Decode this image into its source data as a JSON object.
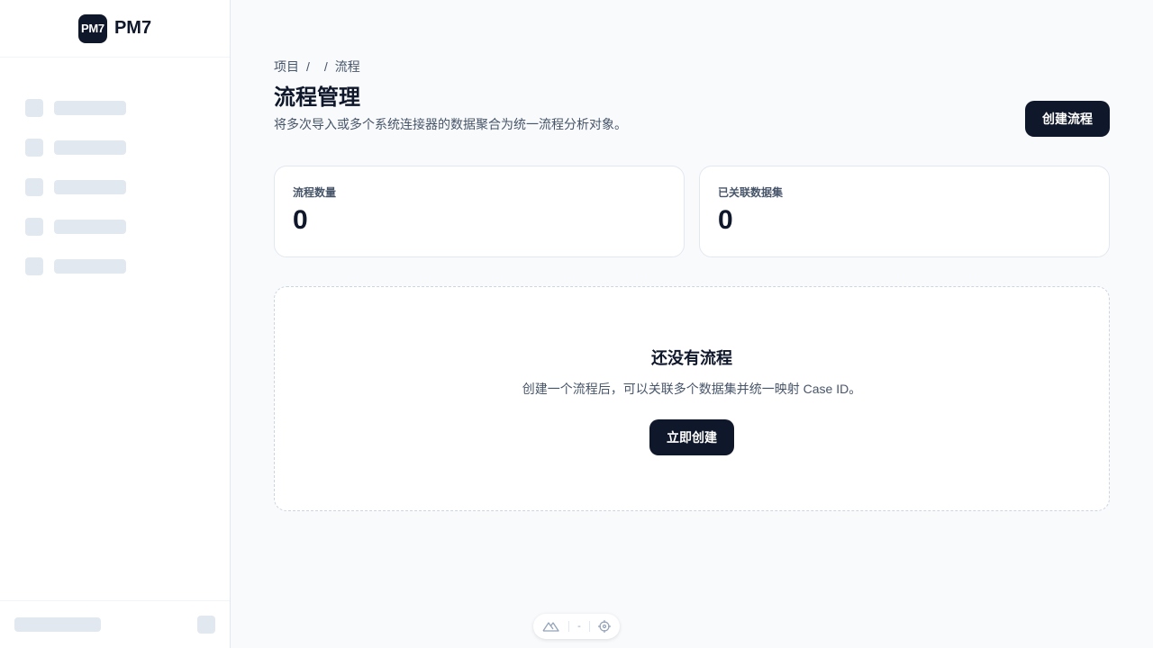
{
  "app": {
    "logo_badge": "PM7",
    "logo_text": "PM7"
  },
  "breadcrumb": {
    "items": [
      "项目",
      "",
      "流程"
    ]
  },
  "header": {
    "title": "流程管理",
    "description": "将多次导入或多个系统连接器的数据聚合为统一流程分析对象。",
    "create_button": "创建流程"
  },
  "stats": [
    {
      "label": "流程数量",
      "value": "0"
    },
    {
      "label": "已关联数据集",
      "value": "0"
    }
  ],
  "empty_state": {
    "title": "还没有流程",
    "description": "创建一个流程后，可以关联多个数据集并统一映射 Case ID。",
    "button": "立即创建"
  },
  "devbar": {
    "value": "-"
  },
  "icons": {
    "logo_mountain": "mountain-icon",
    "target": "crosshair-icon"
  },
  "colors": {
    "primary": "#0f172a",
    "background": "#f8fafc",
    "skeleton": "#e2e8f0"
  }
}
